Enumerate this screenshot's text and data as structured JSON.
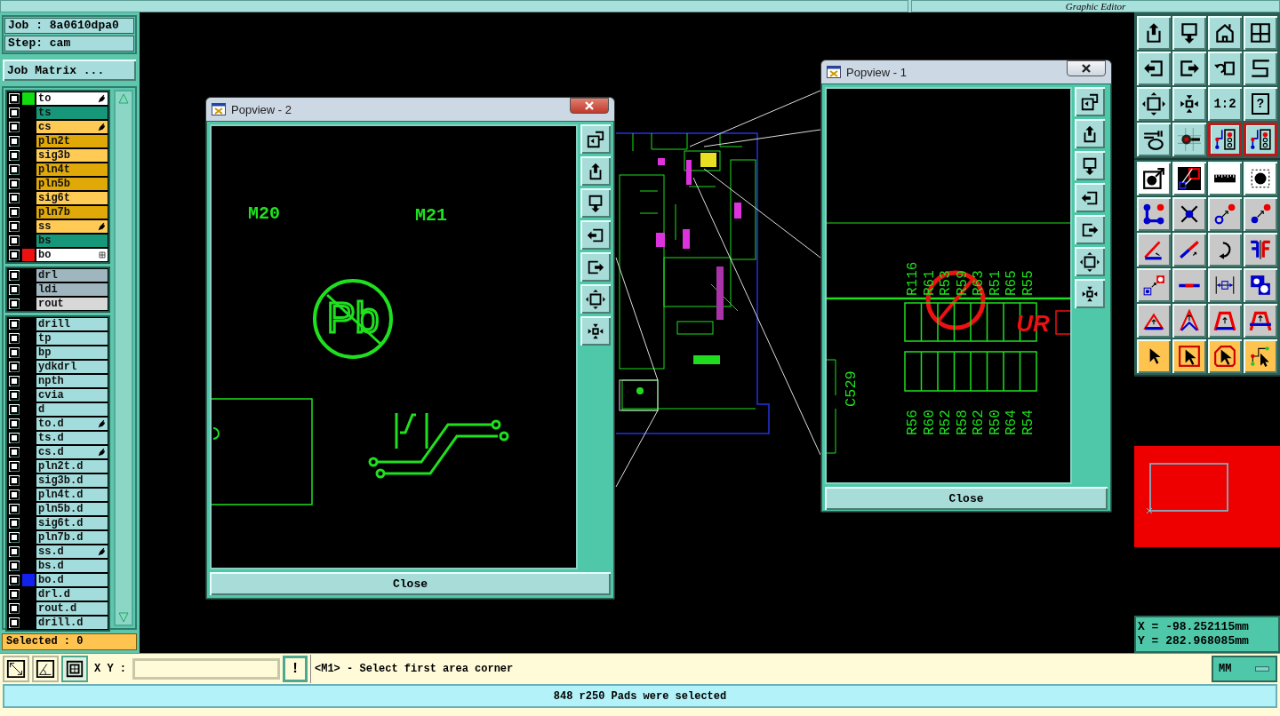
{
  "header": {
    "title": "Graphic Editor"
  },
  "job_panel": {
    "job": "Job : 8a0610dpa0",
    "step": "Step: cam",
    "matrix_button": "Job Matrix ...",
    "selected": "Selected : 0"
  },
  "layer_panel": {
    "groups": [
      {
        "layers": [
          {
            "name": "to",
            "kind": "work",
            "checked": false,
            "affected": true,
            "expandable": false,
            "color": "#11dd11"
          },
          {
            "name": "ts",
            "kind": "mask",
            "checked": false,
            "affected": false,
            "expandable": false
          },
          {
            "name": "cs",
            "kind": "signal",
            "checked": false,
            "affected": true,
            "expandable": false
          },
          {
            "name": "pln2t",
            "kind": "plane",
            "checked": false,
            "affected": false,
            "expandable": false
          },
          {
            "name": "sig3b",
            "kind": "signal",
            "checked": false,
            "affected": false,
            "expandable": false
          },
          {
            "name": "pln4t",
            "kind": "plane",
            "checked": false,
            "affected": false,
            "expandable": false
          },
          {
            "name": "pln5b",
            "kind": "plane",
            "checked": false,
            "affected": false,
            "expandable": false
          },
          {
            "name": "sig6t",
            "kind": "signal",
            "checked": false,
            "affected": false,
            "expandable": false
          },
          {
            "name": "pln7b",
            "kind": "plane",
            "checked": false,
            "affected": false,
            "expandable": false
          },
          {
            "name": "ss",
            "kind": "signal",
            "checked": false,
            "affected": true,
            "expandable": false
          },
          {
            "name": "bs",
            "kind": "mask",
            "checked": false,
            "affected": false,
            "expandable": false
          },
          {
            "name": "bo",
            "kind": "work",
            "checked": false,
            "affected": false,
            "expandable": true,
            "color": "#ee1111"
          }
        ]
      },
      {
        "layers": [
          {
            "name": "drl",
            "kind": "drill",
            "checked": false,
            "affected": false,
            "expandable": false
          },
          {
            "name": "ldi",
            "kind": "drill",
            "checked": false,
            "affected": false,
            "expandable": false
          },
          {
            "name": "rout",
            "kind": "rout",
            "checked": false,
            "affected": false,
            "expandable": false
          }
        ]
      },
      {
        "layers": [
          {
            "name": "drill",
            "kind": "misc",
            "checked": false,
            "affected": false,
            "expandable": false
          },
          {
            "name": "tp",
            "kind": "misc",
            "checked": false,
            "affected": false,
            "expandable": false
          },
          {
            "name": "bp",
            "kind": "misc",
            "checked": false,
            "affected": false,
            "expandable": false
          },
          {
            "name": "ydkdrl",
            "kind": "misc",
            "checked": false,
            "affected": false,
            "expandable": false
          },
          {
            "name": "npth",
            "kind": "misc",
            "checked": false,
            "affected": false,
            "expandable": false
          },
          {
            "name": "cvia",
            "kind": "misc",
            "checked": false,
            "affected": false,
            "expandable": false
          },
          {
            "name": "d",
            "kind": "misc",
            "checked": false,
            "affected": false,
            "expandable": false
          },
          {
            "name": "to.d",
            "kind": "misc",
            "checked": false,
            "affected": true,
            "expandable": false
          },
          {
            "name": "ts.d",
            "kind": "misc",
            "checked": false,
            "affected": false,
            "expandable": false
          },
          {
            "name": "cs.d",
            "kind": "misc",
            "checked": false,
            "affected": true,
            "expandable": false
          },
          {
            "name": "pln2t.d",
            "kind": "misc",
            "checked": false,
            "affected": false,
            "expandable": false
          },
          {
            "name": "sig3b.d",
            "kind": "misc",
            "checked": false,
            "affected": false,
            "expandable": false
          },
          {
            "name": "pln4t.d",
            "kind": "misc",
            "checked": false,
            "affected": false,
            "expandable": false
          },
          {
            "name": "pln5b.d",
            "kind": "misc",
            "checked": false,
            "affected": false,
            "expandable": false
          },
          {
            "name": "sig6t.d",
            "kind": "misc",
            "checked": false,
            "affected": false,
            "expandable": false
          },
          {
            "name": "pln7b.d",
            "kind": "misc",
            "checked": false,
            "affected": false,
            "expandable": false
          },
          {
            "name": "ss.d",
            "kind": "misc",
            "checked": false,
            "affected": true,
            "expandable": false
          },
          {
            "name": "bs.d",
            "kind": "misc",
            "checked": false,
            "affected": false,
            "expandable": false
          },
          {
            "name": "bo.d",
            "kind": "misc",
            "checked": false,
            "affected": false,
            "expandable": false,
            "color": "#1122ee"
          },
          {
            "name": "drl.d",
            "kind": "misc",
            "checked": false,
            "affected": false,
            "expandable": false
          },
          {
            "name": "rout.d",
            "kind": "misc",
            "checked": false,
            "affected": false,
            "expandable": false
          },
          {
            "name": "drill.d",
            "kind": "misc",
            "checked": false,
            "affected": false,
            "expandable": false
          }
        ]
      }
    ]
  },
  "popviews": [
    {
      "title": "Popview - 2",
      "active": true,
      "kind": "symbol",
      "close": "Close",
      "labels": [
        "M20",
        "M21"
      ],
      "symbol": "Pb"
    },
    {
      "title": "Popview - 1",
      "active": false,
      "kind": "resistor-array",
      "close": "Close",
      "top_labels": [
        "R116",
        "R61",
        "R53",
        "R59",
        "R63",
        "R51",
        "R65",
        "R55"
      ],
      "bottom_labels": [
        "R56",
        "R60",
        "R52",
        "R58",
        "R62",
        "R50",
        "R64",
        "R54"
      ],
      "side_label": "C529",
      "mark": "UR"
    }
  ],
  "toolbox": {
    "groups": [
      {
        "tools": [
          {
            "kind": "view",
            "on": false
          },
          {
            "kind": "view",
            "on": false
          },
          {
            "kind": "view",
            "on": false
          },
          {
            "kind": "view",
            "on": false
          },
          {
            "kind": "view",
            "on": false
          },
          {
            "kind": "view",
            "on": false
          },
          {
            "kind": "view",
            "on": false
          },
          {
            "kind": "view",
            "on": false
          },
          {
            "kind": "view",
            "on": false
          },
          {
            "kind": "view",
            "on": false
          },
          {
            "kind": "view",
            "on": false,
            "label": "1:2"
          },
          {
            "kind": "view",
            "on": false,
            "label": "?"
          },
          {
            "kind": "view",
            "on": false
          },
          {
            "kind": "view",
            "on": false
          },
          {
            "kind": "view",
            "on": true
          },
          {
            "kind": "view",
            "on": true
          }
        ]
      },
      {
        "tools": [
          {
            "kind": "mode",
            "on": false
          },
          {
            "kind": "mode",
            "on": false
          },
          {
            "kind": "mode",
            "on": false
          },
          {
            "kind": "mode",
            "on": false
          },
          {
            "kind": "edit",
            "on": false
          },
          {
            "kind": "edit",
            "on": false
          },
          {
            "kind": "edit",
            "on": false
          },
          {
            "kind": "edit",
            "on": false
          },
          {
            "kind": "edit",
            "on": false
          },
          {
            "kind": "edit",
            "on": false
          },
          {
            "kind": "edit",
            "on": false
          },
          {
            "kind": "edit",
            "on": false
          },
          {
            "kind": "edit",
            "on": false
          },
          {
            "kind": "edit",
            "on": false
          },
          {
            "kind": "edit",
            "on": false
          },
          {
            "kind": "edit",
            "on": false
          },
          {
            "kind": "edit",
            "on": false
          },
          {
            "kind": "edit",
            "on": false
          },
          {
            "kind": "edit",
            "on": false
          },
          {
            "kind": "edit",
            "on": false
          },
          {
            "kind": "select",
            "on": false
          },
          {
            "kind": "select",
            "on": false
          },
          {
            "kind": "select",
            "on": false
          },
          {
            "kind": "select",
            "on": false
          }
        ]
      }
    ]
  },
  "coordinates": {
    "x": "X = -98.252115mm",
    "y": "Y = 282.968085mm"
  },
  "command_bar": {
    "tools": [
      {
        "on": false
      },
      {
        "on": false
      },
      {
        "on": true
      }
    ],
    "xy_label": "X Y :",
    "alert_button": "!",
    "message": "<M1> - Select first area corner",
    "units": "MM"
  },
  "status_bar": {
    "message": "848 r250 Pads were selected"
  }
}
